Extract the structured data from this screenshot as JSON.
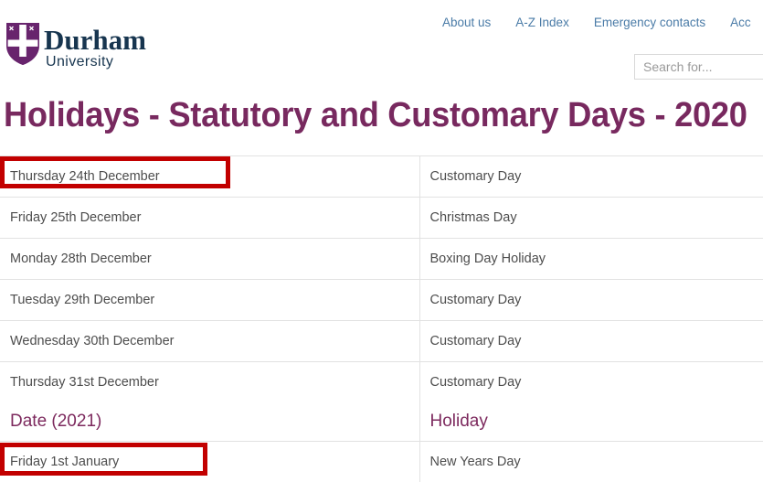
{
  "brand": {
    "logo_name": "durham-university-shield-logo",
    "line1": "Durham",
    "line2": "University",
    "purple": "#68246D",
    "navy": "#17354f"
  },
  "topnav": {
    "items": [
      {
        "label": "About us"
      },
      {
        "label": "A-Z Index"
      },
      {
        "label": "Emergency contacts"
      },
      {
        "label": "Acc"
      }
    ],
    "link_color": "#4a7ba7"
  },
  "search": {
    "placeholder": "Search for...",
    "value": "",
    "icon": "search-icon"
  },
  "page": {
    "title": "Holidays - Statutory and Customary Days - 2020",
    "title_color": "#78295f"
  },
  "annotations": {
    "highlight_color": "#c20000",
    "boxes": [
      {
        "target": "Thursday 24th December"
      },
      {
        "target": "Friday 1st January"
      }
    ]
  },
  "table": {
    "column_headers_2021": {
      "date": "Date (2021)",
      "holiday": "Holiday"
    },
    "rows": [
      {
        "date": "Thursday 24th December",
        "holiday": "Customary Day",
        "highlighted": true,
        "is_header": false
      },
      {
        "date": "Friday 25th December",
        "holiday": "Christmas Day",
        "highlighted": false,
        "is_header": false
      },
      {
        "date": "Monday 28th December",
        "holiday": "Boxing Day Holiday",
        "highlighted": false,
        "is_header": false
      },
      {
        "date": "Tuesday 29th December",
        "holiday": "Customary Day",
        "highlighted": false,
        "is_header": false
      },
      {
        "date": "Wednesday 30th December",
        "holiday": "Customary Day",
        "highlighted": false,
        "is_header": false
      },
      {
        "date": "Thursday 31st December",
        "holiday": "Customary Day",
        "highlighted": false,
        "is_header": false
      },
      {
        "date": "Date (2021)",
        "holiday": "Holiday",
        "highlighted": false,
        "is_header": true
      },
      {
        "date": "Friday 1st January",
        "holiday": "New Years Day",
        "highlighted": true,
        "is_header": false
      }
    ]
  }
}
